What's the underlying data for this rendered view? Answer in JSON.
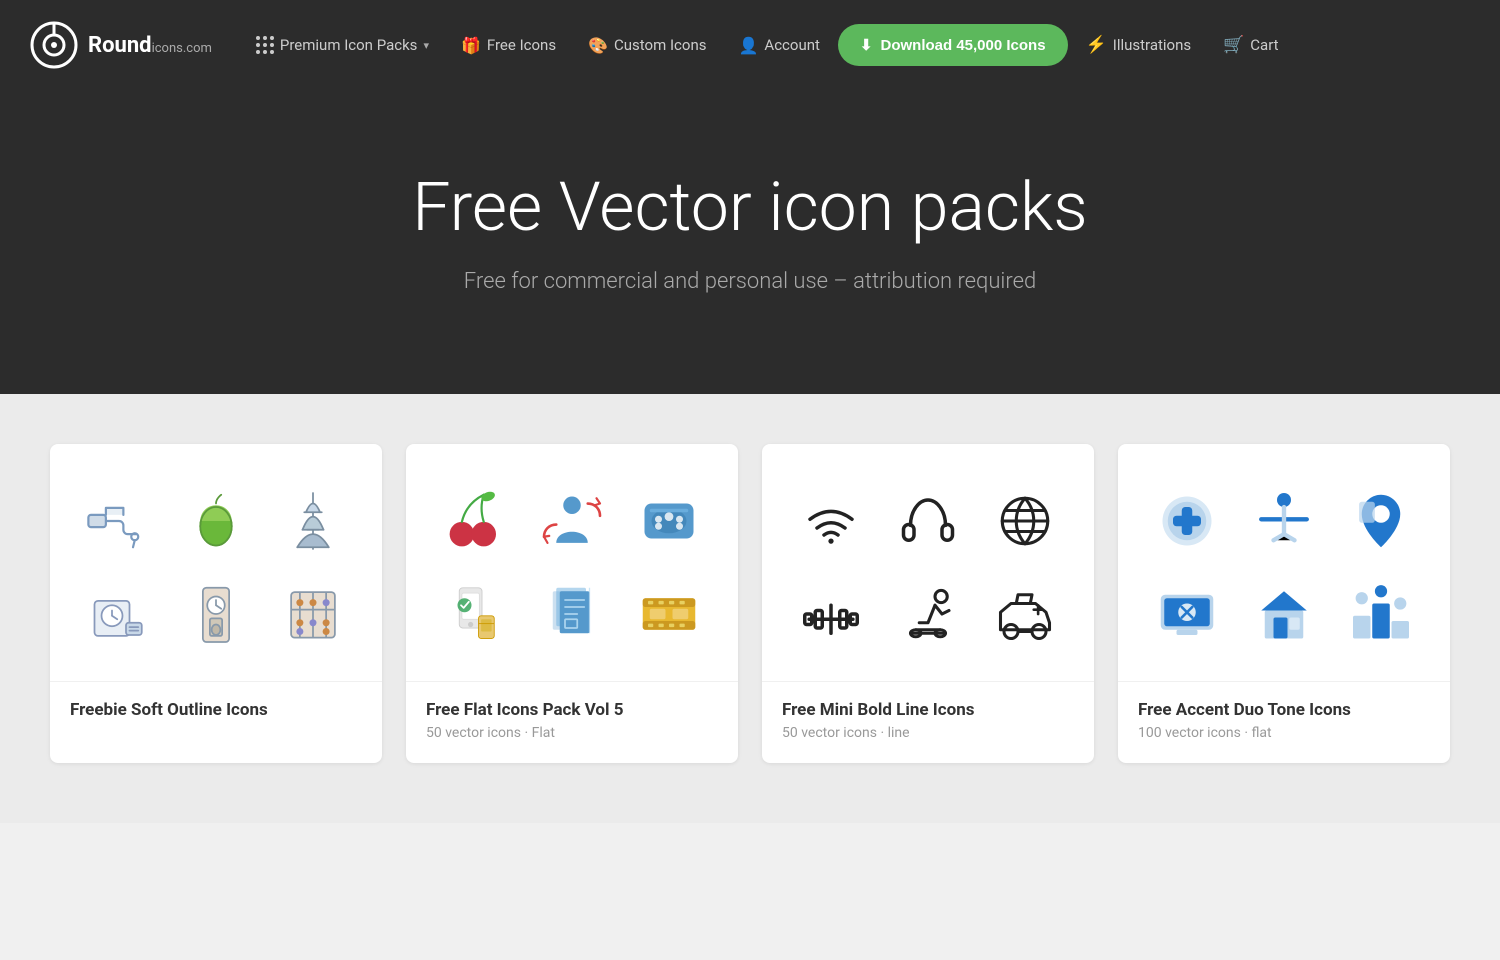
{
  "brand": {
    "name_bold": "Round",
    "name_light": "icons",
    "domain": ".com",
    "logo_alt": "Roundicons logo"
  },
  "nav": {
    "premium_label": "Premium Icon Packs",
    "free_label": "Free Icons",
    "custom_label": "Custom Icons",
    "account_label": "Account",
    "download_label": "Download 45,000 Icons",
    "illustrations_label": "Illustrations",
    "cart_label": "Cart"
  },
  "hero": {
    "title": "Free Vector icon packs",
    "subtitle": "Free for commercial and personal use – attribution required"
  },
  "cards": [
    {
      "id": "card-1",
      "title": "Freebie Soft Outline Icons",
      "subtitle": "",
      "type": "soft-outline"
    },
    {
      "id": "card-2",
      "title": "Free Flat Icons Pack Vol 5",
      "subtitle": "50 vector icons · Flat",
      "type": "flat"
    },
    {
      "id": "card-3",
      "title": "Free Mini Bold Line Icons",
      "subtitle": "50 vector icons · line",
      "type": "line"
    },
    {
      "id": "card-4",
      "title": "Free Accent Duo Tone Icons",
      "subtitle": "100 vector icons · flat",
      "type": "duotone"
    }
  ],
  "colors": {
    "navbar_bg": "#2c2c2c",
    "hero_bg": "#2c2c2c",
    "download_btn": "#5cb85c",
    "page_bg": "#ebebeb"
  }
}
